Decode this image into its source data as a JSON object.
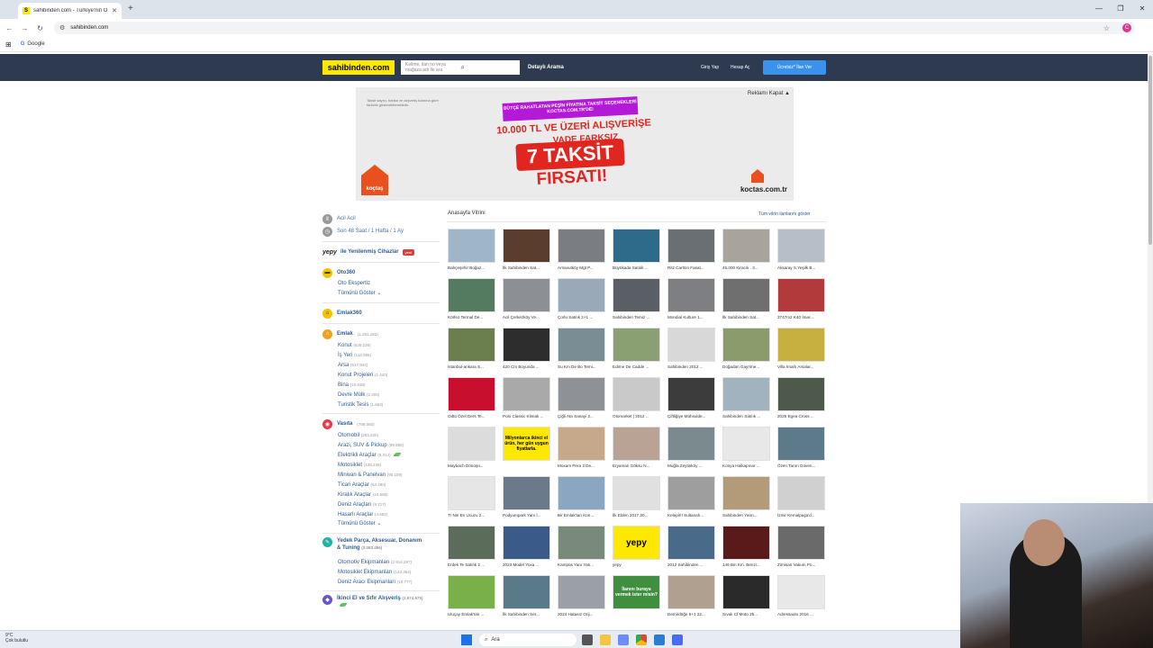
{
  "browser": {
    "tab_title": "sahibinden.com - Türkiye'nin O...",
    "tab_close": "✕",
    "new_tab": "+",
    "favicon_letter": "S",
    "url": "sahibinden.com",
    "bookmark_google": "Google",
    "profile_initial": "C"
  },
  "header": {
    "logo": "sahibinden.com",
    "search_placeholder": "Kelime, ilan no veya mağaza adı ile ara",
    "detailed_search": "Detaylı Arama",
    "login": "Giriş Yap",
    "register": "Hesap Aç",
    "post_ad": "Ücretsiz* İlan Ver"
  },
  "ad": {
    "note": "Taksit sayısı, banka ve alışveriş tutarına göre farklılık gösterebilmektedir.",
    "close": "Reklamı Kapat ▲",
    "ribbon": "BÜTÇE RAHATLATAN PEŞİN FİYATINA TAKSİT SEÇENEKLERİ KOCTAS.COM.TR'DE!",
    "headline": "10.000 TL VE ÜZERİ ALIŞVERİŞE",
    "sub": "VADE FARKSIZ",
    "big": "7 TAKSİT",
    "firsat": "FIRSATI!",
    "brand": "koctas.com.tr",
    "logo_text": "koçtaş"
  },
  "sidebar": {
    "acil": "Acil Acil",
    "son48": "Son 48 Saat / 1 Hafta / 1 Ay",
    "yepy": "yepy",
    "yepy_label": "ile Yenilenmiş Cihazlar",
    "yeni": "yeni",
    "oto360": "Oto360",
    "oto_ekspertiz": "Oto Ekspertiz",
    "tumunu": "Tümünü Göster",
    "emlak360": "Emlak360",
    "emlak": {
      "label": "Emlak",
      "count": "(1.291.183)"
    },
    "emlak_items": [
      {
        "label": "Konut",
        "count": "(639.226)"
      },
      {
        "label": "İş Yeri",
        "count": "(118.096)"
      },
      {
        "label": "Arsa",
        "count": "(517.944)"
      },
      {
        "label": "Konut Projeleri",
        "count": "(1.440)"
      },
      {
        "label": "Bina",
        "count": "(10.638)"
      },
      {
        "label": "Devre Mülk",
        "count": "(2.205)"
      },
      {
        "label": "Turistik Tesis",
        "count": "(1.663)"
      }
    ],
    "vasita": {
      "label": "Vasıta",
      "count": "(799.060)"
    },
    "vasita_items": [
      {
        "label": "Otomobil",
        "count": "(383.220)"
      },
      {
        "label": "Arazi, SUV & Pickup",
        "count": "(99.895)"
      },
      {
        "label": "Elektrikli Araçlar",
        "count": "(9.014)"
      },
      {
        "label": "Motosiklet",
        "count": "(136.249)"
      },
      {
        "label": "Minivan & Panelvan",
        "count": "(90.159)"
      },
      {
        "label": "Ticari Araçlar",
        "count": "(63.480)"
      },
      {
        "label": "Kiralık Araçlar",
        "count": "(10.606)"
      },
      {
        "label": "Deniz Araçları",
        "count": "(9.717)"
      },
      {
        "label": "Hasarlı Araçlar",
        "count": "(4.692)"
      }
    ],
    "yedek": {
      "label": "Yedek Parça, Aksesuar, Donanım & Tuning",
      "count": "(3.083.466)"
    },
    "yedek_items": [
      {
        "label": "Otomotiv Ekipmanları",
        "count": "(2.914.297)"
      },
      {
        "label": "Motosiklet Ekipmanları",
        "count": "(143.354)"
      },
      {
        "label": "Deniz Aracı Ekipmanları",
        "count": "(19.777)"
      }
    ],
    "ikinci": {
      "label": "İkinci El ve Sıfır Alışveriş",
      "count": "(2.974.975)"
    }
  },
  "showcase": {
    "title": "Anasayfa Vitrini",
    "all": "Tüm vitrin ilanlarını göster",
    "items": [
      "Bahçeşehir Boğaz...",
      "İlk Sahibinden Sat...",
      "Arnavutköy Mgt P...",
      "Büyükada Satılık ...",
      "Ritz Carlton Fasat...",
      "45.000 Kiracılı . 3...",
      "Aksaray S.Yeşilk B...",
      "Körfez Termal De...",
      "Acil Çerkezköy Ve...",
      "Çorlu Satılık 2+1 ...",
      "Sahibinden Temiz ...",
      "Mondial Kulture 1...",
      "İlk Sahibinden Sat...",
      "3747m2 K40 İmar...",
      "İstanbul-ankara S...",
      "420 Cm Boyunda ...",
      "Su Km De Bo Temi...",
      "Edirne De Cadde ...",
      "Sahibinden 2012 ...",
      "Doğadan Gayrime...",
      "Villa İmarlı Arsalar...",
      "Odtü Özel Ders Te...",
      "Polo Classic Klimalı ...",
      "Çiğli Ata Sanayi 2...",
      "Otomarket | 2012 ...",
      "Çiftliğiye Mahsulde...",
      "Sahibinden Satılık ...",
      "2025 Egea Cross ...",
      "Maybach Dönüşü...",
      "Milyonlarca ikinci el ürün, her gün uygun fiyatlarla.",
      "Moxam Pera 3 De...",
      "Eryaman Göksu N...",
      "Muğla Zeytinköy ...",
      "Konya Halkapınar ...",
      "Özen Tarım Güven...",
      "Tr Nin En Ucuzu 2...",
      "Podyumpark Yanı İ...",
      "Bir Emlak'tan Kon...",
      "İlk Elden 2017 30...",
      "Kelepir!! Sultanah...",
      "Sahibinden Yatırı...",
      "İzmir Kemalpaşa'd...",
      "Erdek Te Satılık 2 ...",
      "2023 Model Yoxa ...",
      "Kampüs Yanı Yatı...",
      "yepy",
      "2012 Sahibinden ...",
      "146 Bin Km. Benzi...",
      "Zirnisan Vakum Po...",
      "Uluçay Emlak'tan ...",
      "İlk Sahibinden Ser...",
      "2024 Hatasız Orij...",
      "İlanını buraya vermek ister misin?",
      "Demirdöğe 6+1 22...",
      "Sıvalı Cf Moto 25...",
      "Adressauto 2016 ..."
    ]
  },
  "taskbar": {
    "temp": "9°C",
    "weather": "Çok bulutlu",
    "search": "Ara"
  },
  "colors": {
    "header_bg": "#2e3a50",
    "logo_bg": "#ffe800",
    "post_btn": "#3b92ea",
    "link": "#2f5d92"
  }
}
